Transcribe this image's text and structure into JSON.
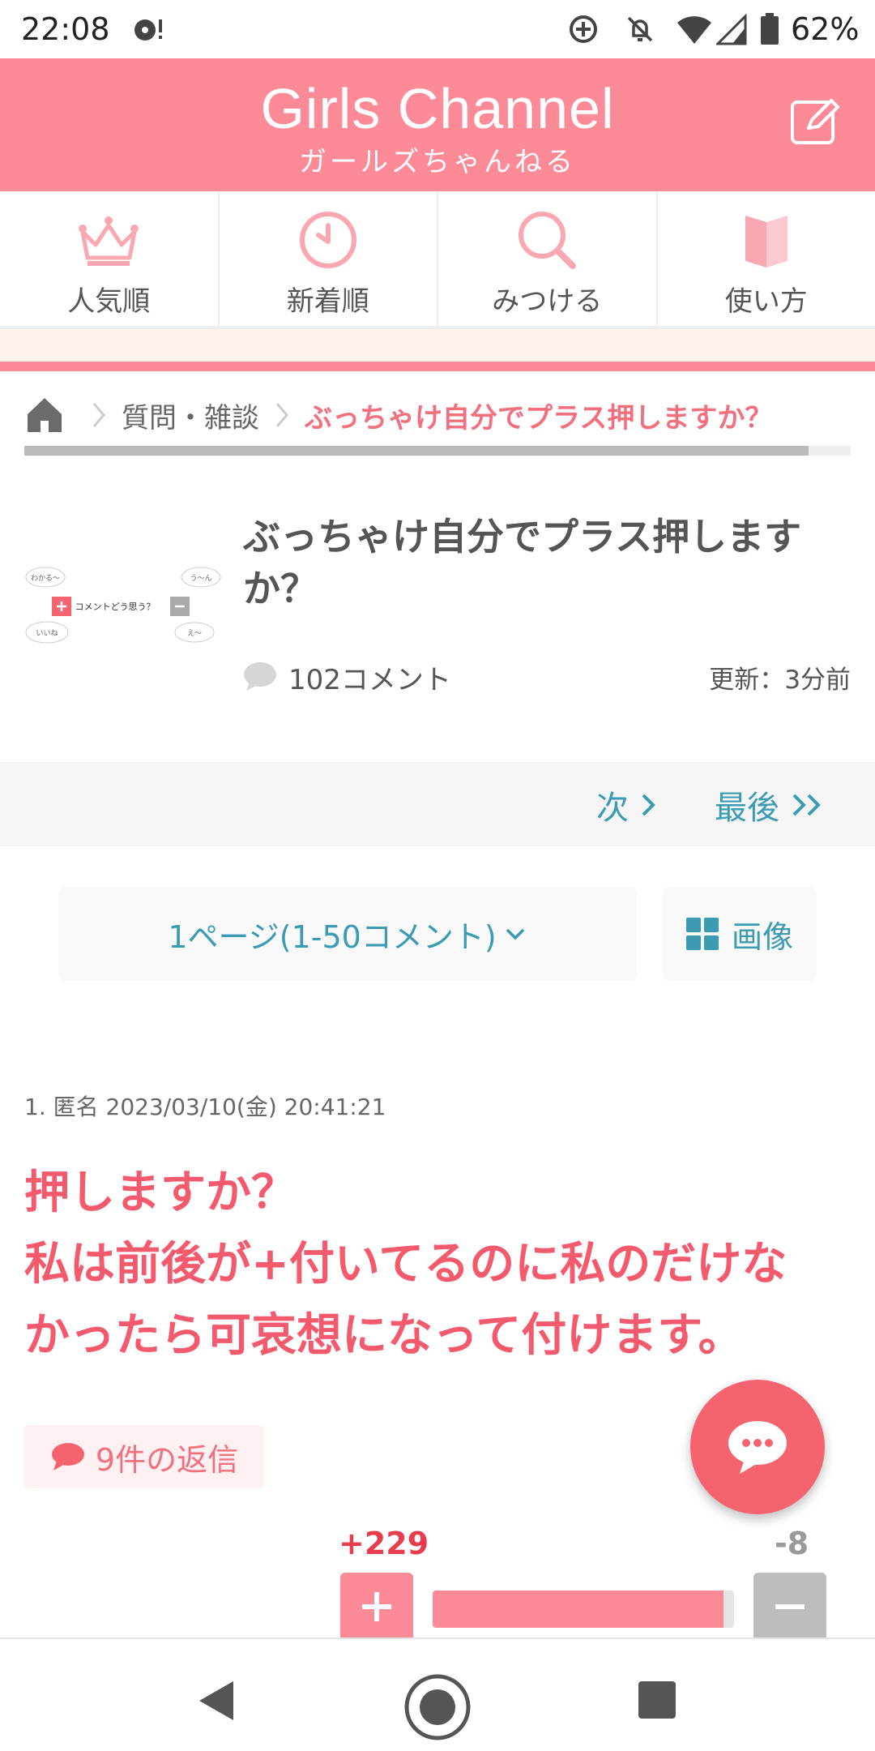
{
  "status_bar": {
    "time": "22:08",
    "battery_percent": "62%",
    "icons": [
      "notification-icon",
      "data-saver-icon",
      "do-not-disturb-icon",
      "wifi-icon",
      "signal-icon",
      "battery-icon"
    ]
  },
  "header": {
    "logo_en": "Girls Channel",
    "logo_jp": "ガールズちゃんねる",
    "post_icon": "edit-icon",
    "brand_color": "#fd8b97"
  },
  "nav": {
    "items": [
      {
        "label": "人気順",
        "icon": "crown-icon"
      },
      {
        "label": "新着順",
        "icon": "clock-icon"
      },
      {
        "label": "みつける",
        "icon": "search-icon"
      },
      {
        "label": "使い方",
        "icon": "book-icon"
      }
    ]
  },
  "breadcrumb": {
    "category": "質問・雑談",
    "current": "ぶっちゃけ自分でプラス押しますか？"
  },
  "topic": {
    "title": "ぶっちゃけ自分でプラス押しますか？",
    "comment_count": "102コメント",
    "updated": "更新：3分前",
    "thumbnail": {
      "center_text": "コメントどう思う？",
      "bubbles": [
        "わかる〜",
        "う〜ん",
        "いいね",
        "え〜"
      ]
    }
  },
  "pager": {
    "next_label": "次",
    "last_label": "最後"
  },
  "page_select": {
    "label": "1ページ(1-50コメント)",
    "image_label": "画像"
  },
  "comment": {
    "header": "1. 匿名 2023/03/10(金) 20:41:21",
    "body_lines": [
      "押しますか？",
      "私は前後が+付いてるのに私のだけな",
      "かったら可哀想になって付けます。"
    ],
    "replies_label": "9件の返信",
    "plus_count": "+229",
    "minus_count": "-8",
    "plus_ratio": 0.966
  },
  "colors": {
    "accent": "#fd8b97",
    "comment_text": "#f35a6e",
    "link": "#3a9bb3"
  }
}
